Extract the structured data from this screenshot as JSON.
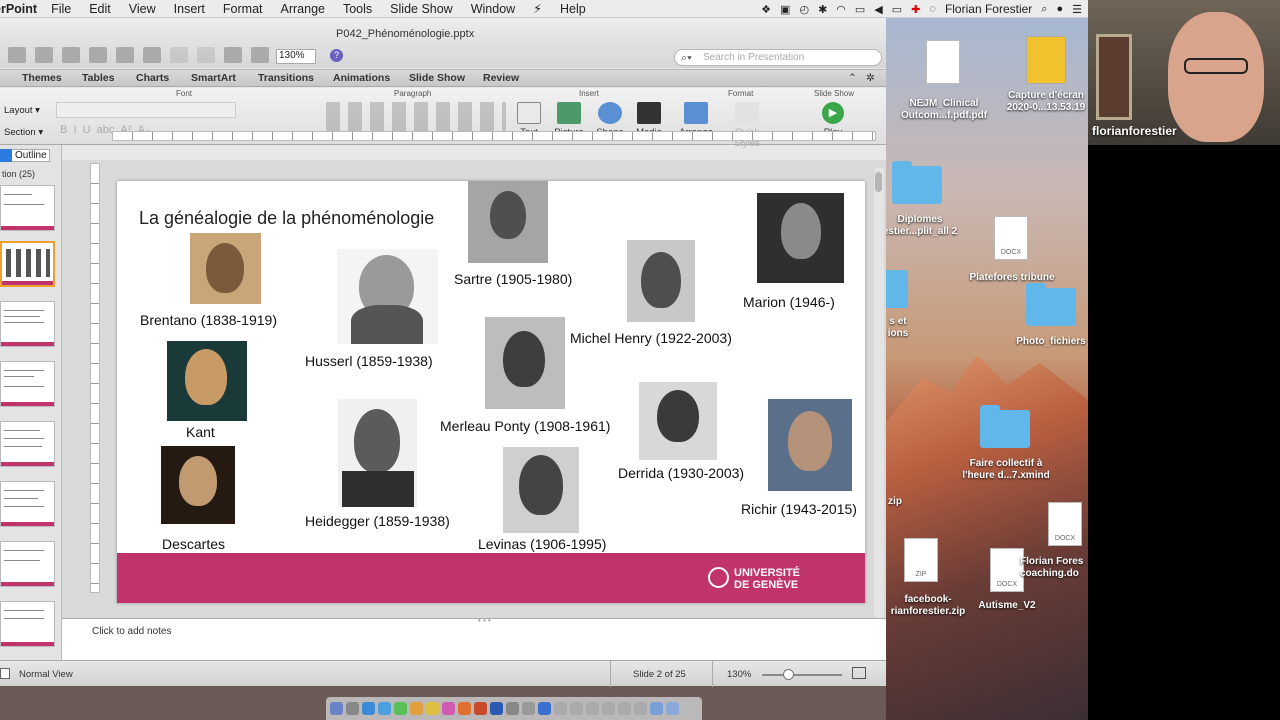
{
  "menubar": {
    "app": "erPoint",
    "items": [
      "File",
      "Edit",
      "View",
      "Insert",
      "Format",
      "Arrange",
      "Tools",
      "Slide Show",
      "Window",
      "⚡︎",
      "Help"
    ],
    "user": "Florian Forestier"
  },
  "window": {
    "title": "P042_Phénoménologie.pptx",
    "zoom": "130%",
    "search_placeholder": "Search in Presentation"
  },
  "ribbon": {
    "tabs": [
      "Themes",
      "Tables",
      "Charts",
      "SmartArt",
      "Transitions",
      "Animations",
      "Slide Show",
      "Review"
    ],
    "groups": [
      "Font",
      "Paragraph",
      "Insert",
      "Format",
      "Slide Show"
    ],
    "left_labels": [
      "Layout",
      "Section"
    ],
    "buttons": [
      "Text",
      "Picture",
      "Shape",
      "Media",
      "Arrange",
      "Quick Styles",
      "Play"
    ]
  },
  "thumbs": {
    "tab": "Outline",
    "header": "tion (25)"
  },
  "slide": {
    "title": "La généalogie de la phénoménologie",
    "people": [
      {
        "name": "Brentano (1838-1919)"
      },
      {
        "name": "Husserl (1859-1938)"
      },
      {
        "name": "Sartre (1905-1980)"
      },
      {
        "name": "Michel Henry (1922-2003)"
      },
      {
        "name": "Marion (1946-)"
      },
      {
        "name": "Kant"
      },
      {
        "name": "Merleau Ponty (1908-1961)"
      },
      {
        "name": "Derrida (1930-2003)"
      },
      {
        "name": "Richir (1943-2015)"
      },
      {
        "name": "Descartes"
      },
      {
        "name": "Heidegger (1859-1938)"
      },
      {
        "name": "Levinas (1906-1995)"
      }
    ],
    "logo": [
      "UNIVERSITÉ",
      "DE GENÈVE"
    ]
  },
  "notes": {
    "placeholder": "Click to add notes"
  },
  "status": {
    "view": "Normal View",
    "slide_counter": "Slide 2 of 25",
    "zoom": "130%"
  },
  "desktop": {
    "icons": [
      {
        "label": "NEJM_Clinical Outcom...f.pdf.pdf"
      },
      {
        "label": "Capture d'écran 2020-0...13.53.19"
      },
      {
        "label": "Diplomes estier...plit_all 2"
      },
      {
        "label": "Platefores tribune"
      },
      {
        "label": "s et ions"
      },
      {
        "label": "Photo_fichiers"
      },
      {
        "label": "Faire collectif à l'heure d...7.xmind"
      },
      {
        "label": "zip"
      },
      {
        "label": "facebook- rianforestier.zip"
      },
      {
        "label": "Autisme_V2"
      },
      {
        "label": "Florian Fores coaching.do"
      }
    ]
  },
  "webcam": {
    "name": "florianforestier"
  },
  "colors": {
    "accent": "#c0336b",
    "folder": "#62b7ea"
  }
}
